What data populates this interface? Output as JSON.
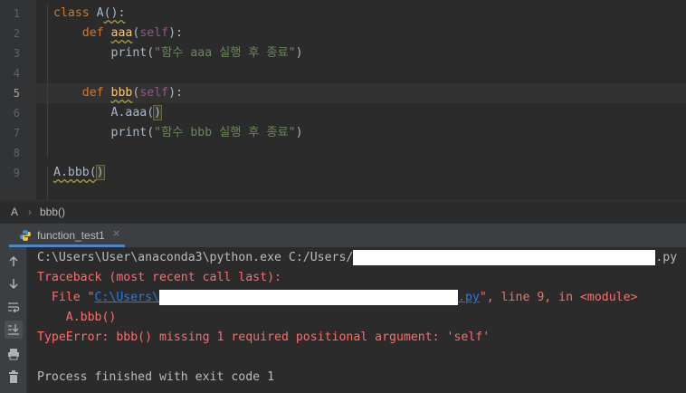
{
  "editor": {
    "line_numbers": [
      "1",
      "2",
      "3",
      "4",
      "5",
      "6",
      "7",
      "8",
      "9"
    ],
    "lines": {
      "l1": {
        "kw": "class",
        "rest": " A",
        "paren": "():"
      },
      "l2": {
        "kw": "def",
        "fn": "aaa",
        "open": "(",
        "self": "self",
        "close": "):"
      },
      "l3": {
        "print": "print(",
        "str": "\"함수 aaa 실행 후 종료\"",
        "close": ")"
      },
      "l5": {
        "kw": "def",
        "fn": "bbb",
        "open": "(",
        "self": "self",
        "close": "):"
      },
      "l6": {
        "call": "A.aaa(",
        "close": ")"
      },
      "l7": {
        "print": "print(",
        "str": "\"함수 bbb 실행 후 종료\"",
        "close": ")"
      },
      "l9": {
        "call": "A.bbb(",
        "close": ")"
      }
    }
  },
  "breadcrumb": {
    "class": "A",
    "separator": "›",
    "method": "bbb()"
  },
  "run_panel": {
    "tab_label": "function_test1",
    "close": "×"
  },
  "console": {
    "cmd_prefix": "C:\\Users\\User\\anaconda3\\python.exe C:/Users/",
    "cmd_suffix": ".py",
    "traceback": "Traceback (most recent call last):",
    "file_prefix": "  File \"",
    "file_link_start": "C:\\Users\\",
    "file_link_end": ".py",
    "file_suffix": "\", line 9, in <module>",
    "code_line": "    A.bbb()",
    "error": "TypeError: bbb() missing 1 required positional argument: 'self'",
    "exit": "Process finished with exit code 1"
  },
  "toolbar_icons": [
    "arrow-up-icon",
    "arrow-down-icon",
    "soft-wrap-icon",
    "scroll-to-end-icon",
    "print-icon",
    "trash-icon"
  ],
  "colors": {
    "keyword": "#cc7832",
    "function": "#ffc66d",
    "self": "#94558d",
    "string": "#6a8759",
    "error": "#ff6b68",
    "link": "#287bde",
    "tab_underline": "#4a88c7"
  }
}
